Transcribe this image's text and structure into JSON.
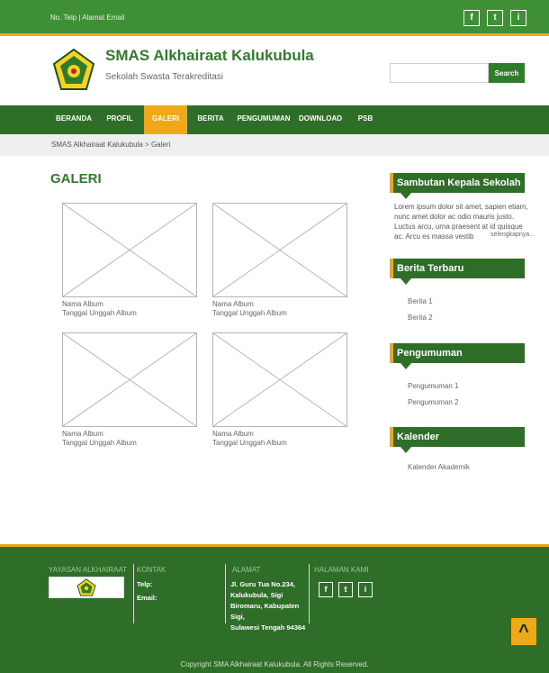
{
  "topbar": {
    "contact_text": "No. Telp | Alamat Email",
    "social": [
      "f",
      "t",
      "i"
    ]
  },
  "header": {
    "title": "SMAS Alkhairaat Kalukubula",
    "subtitle": "Sekolah Swasta Terakreditasi",
    "search_placeholder": "",
    "search_button": "Search"
  },
  "nav": {
    "items": [
      "BERANDA",
      "PROFIL",
      "GALERI",
      "BERITA",
      "PENGUMUMAN",
      "DOWNLOAD",
      "PSB"
    ],
    "active_index": 2
  },
  "breadcrumb": "SMAS Alkhairaat Kalukubula > Galeri",
  "main": {
    "title": "GALERI",
    "albums": [
      {
        "name": "Nama Album",
        "date": "Tanggal Unggah Album"
      },
      {
        "name": "Nama Album",
        "date": "Tanggal Unggah Album"
      },
      {
        "name": "Nama Album",
        "date": "Tanggal Unggah Album"
      },
      {
        "name": "Nama Album",
        "date": "Tanggal Unggah Album"
      }
    ]
  },
  "sidebar": {
    "sambutan_title": "Sambutan Kepala Sekolah",
    "sambutan_text": "Lorem ipsum dolor sit amet, sapien etiam, nunc amet dolor ac odio mauris justo. Luctus arcu, urna praesent at id quisque ac. Arcu es massa vestib",
    "sambutan_more": "selengkapnya...",
    "berita_title": "Berita Terbaru",
    "berita_items": [
      "Berita 1",
      "Berita 2"
    ],
    "pengumuman_title": "Pengumuman",
    "pengumuman_items": [
      "Pengumuman 1",
      "Pengumuman 2"
    ],
    "kalender_title": "Kalender",
    "kalender_items": [
      "Kalender Akademik"
    ]
  },
  "footer": {
    "yayasan_heading": "YAYASAN ALKHAIRAAT",
    "kontak_heading": "KONTAK",
    "kontak_telp": "Telp:",
    "kontak_email": "Email:",
    "alamat_heading": "ALAMAT",
    "alamat_lines": [
      "Jl. Guru Tua No.234,",
      "Kalukubula, Sigi",
      "Biromaru, Kabupaten",
      "Sigi,",
      "Sulawesi Tengah 94364"
    ],
    "halaman_heading": "HALAMAN KAMI",
    "social": [
      "f",
      "t",
      "i"
    ],
    "copyright": "Copyright SMA Alkhairaat Kalukubula. All Rights Reserved.",
    "to_top": "^"
  },
  "colors": {
    "green": "#2f6e28",
    "green_light": "#3f8f37",
    "accent": "#f0a818"
  }
}
